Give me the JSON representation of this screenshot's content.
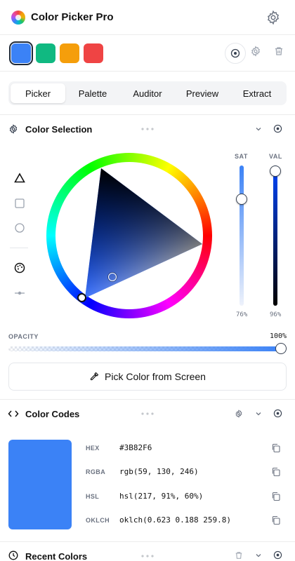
{
  "app": {
    "title": "Color Picker Pro",
    "settings_icon": "gear-icon"
  },
  "swatches": [
    {
      "color": "#3B82F6",
      "selected": true
    },
    {
      "color": "#10B981",
      "selected": false
    },
    {
      "color": "#F59E0B",
      "selected": false
    },
    {
      "color": "#EF4444",
      "selected": false
    }
  ],
  "tabs": [
    {
      "label": "Picker",
      "active": true
    },
    {
      "label": "Palette",
      "active": false
    },
    {
      "label": "Auditor",
      "active": false
    },
    {
      "label": "Preview",
      "active": false
    },
    {
      "label": "Extract",
      "active": false
    }
  ],
  "color_selection": {
    "title": "Color Selection",
    "tools": [
      "triangle-icon",
      "square-icon",
      "circle-icon",
      "palette-icon",
      "slider-icon"
    ],
    "sat": {
      "label": "SAT",
      "value": "76%",
      "fraction": 0.76
    },
    "val": {
      "label": "VAL",
      "value": "96%",
      "fraction": 0.96
    },
    "hue_color": "#0047FF"
  },
  "opacity": {
    "label": "OPACITY",
    "value": "100%",
    "fraction": 1.0
  },
  "pick_button": {
    "label": "Pick Color from Screen"
  },
  "color_codes": {
    "title": "Color Codes",
    "preview_color": "#3B82F6",
    "rows": [
      {
        "label": "HEX",
        "value": "#3B82F6"
      },
      {
        "label": "RGBA",
        "value": "rgb(59, 130, 246)"
      },
      {
        "label": "HSL",
        "value": "hsl(217, 91%, 60%)"
      },
      {
        "label": "OKLCH",
        "value": "oklch(0.623 0.188 259.8)"
      }
    ]
  },
  "recent_colors": {
    "title": "Recent Colors"
  }
}
